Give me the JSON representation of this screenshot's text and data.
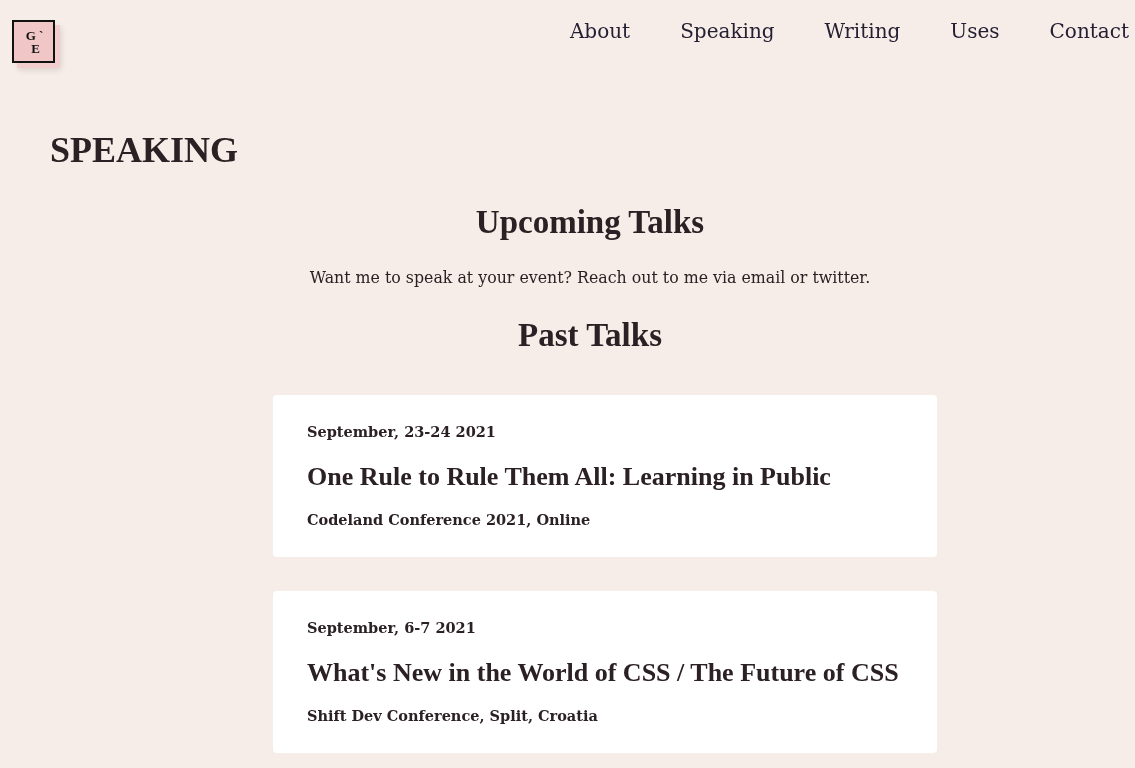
{
  "logo": {
    "lines": [
      "G `",
      "E"
    ]
  },
  "nav": [
    "About",
    "Speaking",
    "Writing",
    "Uses",
    "Contact"
  ],
  "page_title": "SPEAKING",
  "upcoming": {
    "heading": "Upcoming Talks",
    "text": "Want me to speak at your event? Reach out to me via email or twitter."
  },
  "past": {
    "heading": "Past Talks",
    "talks": [
      {
        "date": "September, 23-24 2021",
        "title": "One Rule to Rule Them All: Learning in Public",
        "venue": "Codeland Conference 2021, Online"
      },
      {
        "date": "September, 6-7 2021",
        "title": "What's New in the World of CSS / The Future of CSS",
        "venue": "Shift Dev Conference, Split, Croatia"
      }
    ]
  }
}
